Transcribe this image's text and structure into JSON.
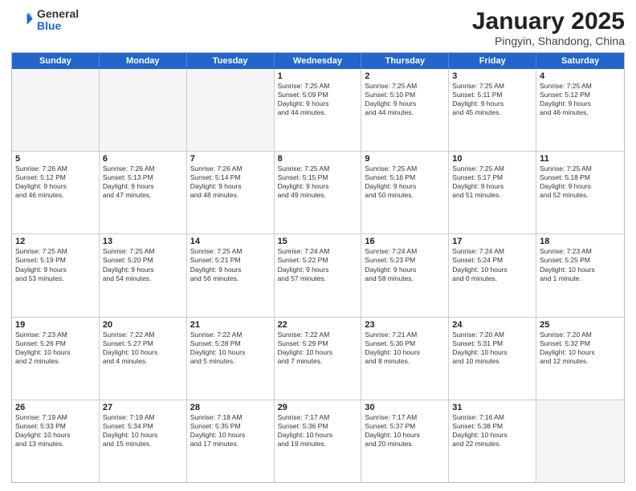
{
  "logo": {
    "general": "General",
    "blue": "Blue"
  },
  "title": "January 2025",
  "subtitle": "Pingyin, Shandong, China",
  "header_days": [
    "Sunday",
    "Monday",
    "Tuesday",
    "Wednesday",
    "Thursday",
    "Friday",
    "Saturday"
  ],
  "weeks": [
    [
      {
        "day": "",
        "info": "",
        "empty": true
      },
      {
        "day": "",
        "info": "",
        "empty": true
      },
      {
        "day": "",
        "info": "",
        "empty": true
      },
      {
        "day": "1",
        "info": "Sunrise: 7:25 AM\nSunset: 5:09 PM\nDaylight: 9 hours\nand 44 minutes."
      },
      {
        "day": "2",
        "info": "Sunrise: 7:25 AM\nSunset: 5:10 PM\nDaylight: 9 hours\nand 44 minutes."
      },
      {
        "day": "3",
        "info": "Sunrise: 7:25 AM\nSunset: 5:11 PM\nDaylight: 9 hours\nand 45 minutes."
      },
      {
        "day": "4",
        "info": "Sunrise: 7:25 AM\nSunset: 5:12 PM\nDaylight: 9 hours\nand 46 minutes."
      }
    ],
    [
      {
        "day": "5",
        "info": "Sunrise: 7:26 AM\nSunset: 5:12 PM\nDaylight: 9 hours\nand 46 minutes."
      },
      {
        "day": "6",
        "info": "Sunrise: 7:26 AM\nSunset: 5:13 PM\nDaylight: 9 hours\nand 47 minutes."
      },
      {
        "day": "7",
        "info": "Sunrise: 7:26 AM\nSunset: 5:14 PM\nDaylight: 9 hours\nand 48 minutes."
      },
      {
        "day": "8",
        "info": "Sunrise: 7:25 AM\nSunset: 5:15 PM\nDaylight: 9 hours\nand 49 minutes."
      },
      {
        "day": "9",
        "info": "Sunrise: 7:25 AM\nSunset: 5:16 PM\nDaylight: 9 hours\nand 50 minutes."
      },
      {
        "day": "10",
        "info": "Sunrise: 7:25 AM\nSunset: 5:17 PM\nDaylight: 9 hours\nand 51 minutes."
      },
      {
        "day": "11",
        "info": "Sunrise: 7:25 AM\nSunset: 5:18 PM\nDaylight: 9 hours\nand 52 minutes."
      }
    ],
    [
      {
        "day": "12",
        "info": "Sunrise: 7:25 AM\nSunset: 5:19 PM\nDaylight: 9 hours\nand 53 minutes."
      },
      {
        "day": "13",
        "info": "Sunrise: 7:25 AM\nSunset: 5:20 PM\nDaylight: 9 hours\nand 54 minutes."
      },
      {
        "day": "14",
        "info": "Sunrise: 7:25 AM\nSunset: 5:21 PM\nDaylight: 9 hours\nand 56 minutes."
      },
      {
        "day": "15",
        "info": "Sunrise: 7:24 AM\nSunset: 5:22 PM\nDaylight: 9 hours\nand 57 minutes."
      },
      {
        "day": "16",
        "info": "Sunrise: 7:24 AM\nSunset: 5:23 PM\nDaylight: 9 hours\nand 58 minutes."
      },
      {
        "day": "17",
        "info": "Sunrise: 7:24 AM\nSunset: 5:24 PM\nDaylight: 10 hours\nand 0 minutes."
      },
      {
        "day": "18",
        "info": "Sunrise: 7:23 AM\nSunset: 5:25 PM\nDaylight: 10 hours\nand 1 minute."
      }
    ],
    [
      {
        "day": "19",
        "info": "Sunrise: 7:23 AM\nSunset: 5:26 PM\nDaylight: 10 hours\nand 2 minutes."
      },
      {
        "day": "20",
        "info": "Sunrise: 7:22 AM\nSunset: 5:27 PM\nDaylight: 10 hours\nand 4 minutes."
      },
      {
        "day": "21",
        "info": "Sunrise: 7:22 AM\nSunset: 5:28 PM\nDaylight: 10 hours\nand 5 minutes."
      },
      {
        "day": "22",
        "info": "Sunrise: 7:22 AM\nSunset: 5:29 PM\nDaylight: 10 hours\nand 7 minutes."
      },
      {
        "day": "23",
        "info": "Sunrise: 7:21 AM\nSunset: 5:30 PM\nDaylight: 10 hours\nand 8 minutes."
      },
      {
        "day": "24",
        "info": "Sunrise: 7:20 AM\nSunset: 5:31 PM\nDaylight: 10 hours\nand 10 minutes."
      },
      {
        "day": "25",
        "info": "Sunrise: 7:20 AM\nSunset: 5:32 PM\nDaylight: 10 hours\nand 12 minutes."
      }
    ],
    [
      {
        "day": "26",
        "info": "Sunrise: 7:19 AM\nSunset: 5:33 PM\nDaylight: 10 hours\nand 13 minutes."
      },
      {
        "day": "27",
        "info": "Sunrise: 7:19 AM\nSunset: 5:34 PM\nDaylight: 10 hours\nand 15 minutes."
      },
      {
        "day": "28",
        "info": "Sunrise: 7:18 AM\nSunset: 5:35 PM\nDaylight: 10 hours\nand 17 minutes."
      },
      {
        "day": "29",
        "info": "Sunrise: 7:17 AM\nSunset: 5:36 PM\nDaylight: 10 hours\nand 19 minutes."
      },
      {
        "day": "30",
        "info": "Sunrise: 7:17 AM\nSunset: 5:37 PM\nDaylight: 10 hours\nand 20 minutes."
      },
      {
        "day": "31",
        "info": "Sunrise: 7:16 AM\nSunset: 5:38 PM\nDaylight: 10 hours\nand 22 minutes."
      },
      {
        "day": "",
        "info": "",
        "empty": true
      }
    ]
  ]
}
